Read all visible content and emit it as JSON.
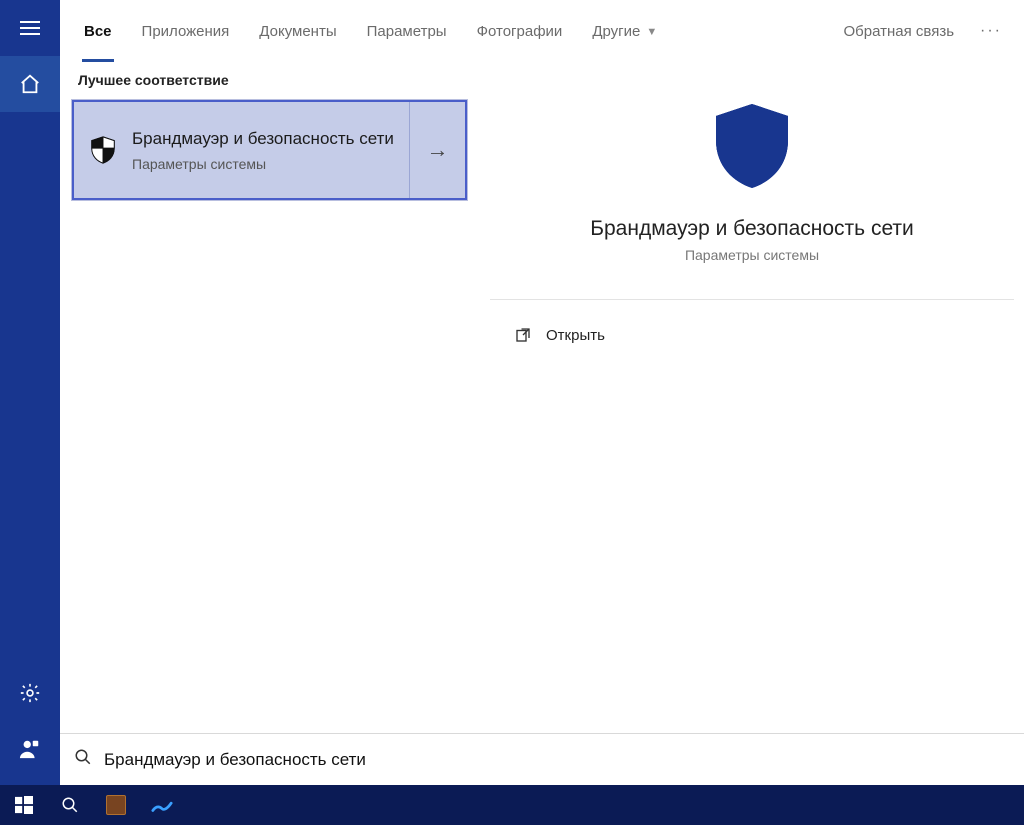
{
  "tabs": {
    "all": "Все",
    "apps": "Приложения",
    "docs": "Документы",
    "settings": "Параметры",
    "photos": "Фотографии",
    "more": "Другие"
  },
  "header": {
    "feedback": "Обратная связь"
  },
  "results": {
    "best_match_label": "Лучшее соответствие",
    "items": [
      {
        "title": "Брандмауэр и безопасность сети",
        "subtitle": "Параметры системы"
      }
    ]
  },
  "preview": {
    "title": "Брандмауэр и безопасность сети",
    "subtitle": "Параметры системы",
    "actions": {
      "open": "Открыть"
    }
  },
  "search": {
    "query": "Брандмауэр и безопасность сети"
  }
}
